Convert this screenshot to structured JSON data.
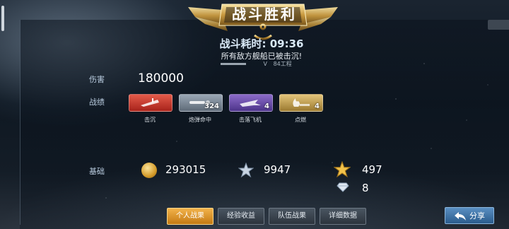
{
  "header": {
    "title": "战斗胜利",
    "battle_time": "战斗耗时: 09:36",
    "sunk_message": "所有敌方舰船已被击沉!",
    "ship_class": "V",
    "ship_name": "84工程"
  },
  "damage": {
    "label": "伤害",
    "value": "180000"
  },
  "record": {
    "label": "战绩",
    "items": [
      {
        "label": "击沉",
        "count": "",
        "color": "#c83a2e",
        "icon": "sinking-ship-icon"
      },
      {
        "label": "炮弹命中",
        "count": "324",
        "color": "#7d8a97",
        "icon": "shell-hit-icon"
      },
      {
        "label": "击落飞机",
        "count": "4",
        "color": "#6a4fb0",
        "icon": "plane-shot-icon"
      },
      {
        "label": "点燃",
        "count": "4",
        "color": "#c6a24e",
        "icon": "fire-icon"
      }
    ]
  },
  "base": {
    "label": "基础",
    "coins": "293015",
    "exp": "9947",
    "star_points": "497",
    "diamonds": "8"
  },
  "tabs": [
    {
      "label": "个人战果",
      "active": true
    },
    {
      "label": "经验收益",
      "active": false
    },
    {
      "label": "队伍战果",
      "active": false
    },
    {
      "label": "详细数据",
      "active": false
    }
  ],
  "share_label": "分享"
}
